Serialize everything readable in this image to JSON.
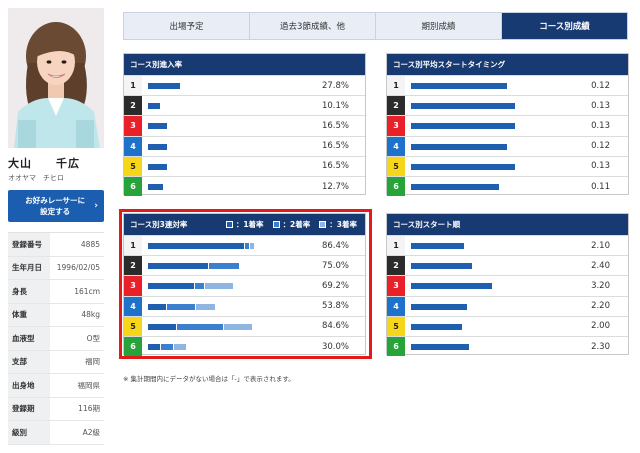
{
  "profile": {
    "name": "大山　　千広",
    "kana": "オオヤマ　チヒロ",
    "fav_button_line1": "お好みレーサーに",
    "fav_button_line2": "設定する",
    "fav_button_chevron": "›",
    "details": [
      {
        "label": "登録番号",
        "value": "4885"
      },
      {
        "label": "生年月日",
        "value": "1996/02/05"
      },
      {
        "label": "身長",
        "value": "161cm"
      },
      {
        "label": "体重",
        "value": "48kg"
      },
      {
        "label": "血液型",
        "value": "O型"
      },
      {
        "label": "支部",
        "value": "福岡"
      },
      {
        "label": "出身地",
        "value": "福岡県"
      },
      {
        "label": "登録期",
        "value": "116期"
      },
      {
        "label": "級別",
        "value": "A2級"
      }
    ]
  },
  "tabs": [
    {
      "label": "出場予定",
      "active": false
    },
    {
      "label": "過去3節成績、他",
      "active": false
    },
    {
      "label": "期別成績",
      "active": false
    },
    {
      "label": "コース別成績",
      "active": true
    }
  ],
  "lane_colors": [
    {
      "lane": "1",
      "bg": "#f4f4f4",
      "fg": "#222222"
    },
    {
      "lane": "2",
      "bg": "#2b2b2b",
      "fg": "#ffffff"
    },
    {
      "lane": "3",
      "bg": "#e8202a",
      "fg": "#ffffff"
    },
    {
      "lane": "4",
      "bg": "#1f72c9",
      "fg": "#ffffff"
    },
    {
      "lane": "5",
      "bg": "#f7d51a",
      "fg": "#222222"
    },
    {
      "lane": "6",
      "bg": "#27a33a",
      "fg": "#ffffff"
    }
  ],
  "colors": {
    "header": "#173a73",
    "bar": "#1f5fb0",
    "bar_second": "#3b7fcf",
    "bar_third": "#8fb6e3",
    "highlight": "#e21a1a"
  },
  "panels": {
    "entry_rate": {
      "title": "コース別進入率",
      "rows": [
        {
          "lane": "1",
          "value": "27.8%",
          "pct": 27.8
        },
        {
          "lane": "2",
          "value": "10.1%",
          "pct": 10.1
        },
        {
          "lane": "3",
          "value": "16.5%",
          "pct": 16.5
        },
        {
          "lane": "4",
          "value": "16.5%",
          "pct": 16.5
        },
        {
          "lane": "5",
          "value": "16.5%",
          "pct": 16.5
        },
        {
          "lane": "6",
          "value": "12.7%",
          "pct": 12.7
        }
      ]
    },
    "avg_start": {
      "title": "コース別平均スタートタイミング",
      "rows": [
        {
          "lane": "1",
          "value": "0.12",
          "num": 0.12
        },
        {
          "lane": "2",
          "value": "0.13",
          "num": 0.13
        },
        {
          "lane": "3",
          "value": "0.13",
          "num": 0.13
        },
        {
          "lane": "4",
          "value": "0.12",
          "num": 0.12
        },
        {
          "lane": "5",
          "value": "0.13",
          "num": 0.13
        },
        {
          "lane": "6",
          "value": "0.11",
          "num": 0.11
        }
      ]
    },
    "top3_rate": {
      "title": "コース別3連対率",
      "legend": [
        {
          "label": "：1着率",
          "color": "#1f5fb0"
        },
        {
          "label": "：2着率",
          "color": "#3b7fcf"
        },
        {
          "label": "：3着率",
          "color": "#8fb6e3"
        }
      ],
      "rows": [
        {
          "lane": "1",
          "value": "86.4%",
          "first": 80.0,
          "second": 3.0,
          "third": 3.4
        },
        {
          "lane": "2",
          "value": "75.0%",
          "first": 50.0,
          "second": 25.0,
          "third": 0
        },
        {
          "lane": "3",
          "value": "69.2%",
          "first": 38.5,
          "second": 7.7,
          "third": 23.0
        },
        {
          "lane": "4",
          "value": "53.8%",
          "first": 15.4,
          "second": 23.1,
          "third": 15.3
        },
        {
          "lane": "5",
          "value": "84.6%",
          "first": 23.1,
          "second": 38.5,
          "third": 23.0
        },
        {
          "lane": "6",
          "value": "30.0%",
          "first": 10.0,
          "second": 10.0,
          "third": 10.0
        }
      ]
    },
    "start_order": {
      "title": "コース別スタート順",
      "rows": [
        {
          "lane": "1",
          "value": "2.10",
          "num": 2.1
        },
        {
          "lane": "2",
          "value": "2.40",
          "num": 2.4
        },
        {
          "lane": "3",
          "value": "3.20",
          "num": 3.2
        },
        {
          "lane": "4",
          "value": "2.20",
          "num": 2.2
        },
        {
          "lane": "5",
          "value": "2.00",
          "num": 2.0
        },
        {
          "lane": "6",
          "value": "2.30",
          "num": 2.3
        }
      ]
    }
  },
  "footnote": "※ 集計期間内にデータがない場合は「-」で表示されます。"
}
